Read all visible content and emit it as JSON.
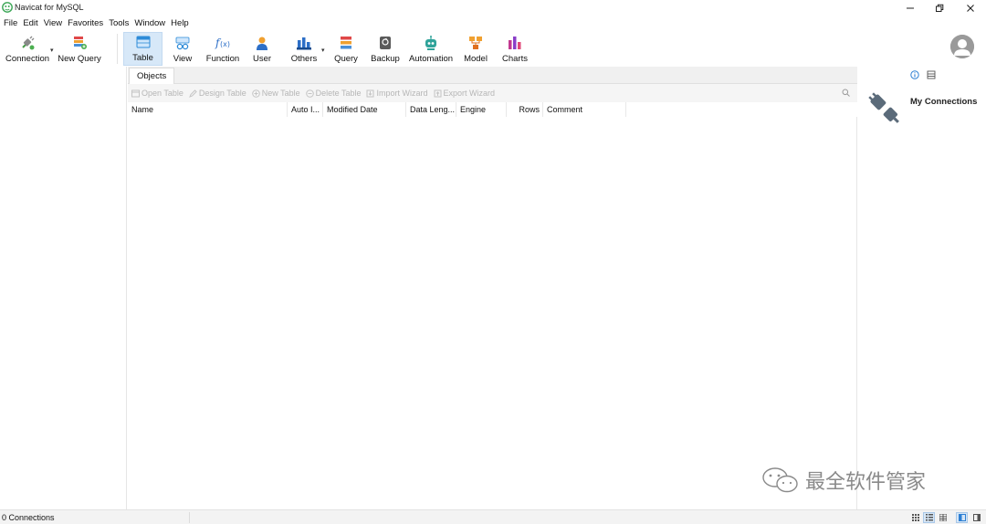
{
  "window": {
    "title": "Navicat for MySQL"
  },
  "menu": [
    "File",
    "Edit",
    "View",
    "Favorites",
    "Tools",
    "Window",
    "Help"
  ],
  "toolbar": {
    "connection": "Connection",
    "new_query": "New Query",
    "table": "Table",
    "view": "View",
    "function": "Function",
    "user": "User",
    "others": "Others",
    "query": "Query",
    "backup": "Backup",
    "automation": "Automation",
    "model": "Model",
    "charts": "Charts",
    "active": "Table"
  },
  "main": {
    "tab": "Objects",
    "actions": [
      "Open Table",
      "Design Table",
      "New Table",
      "Delete Table",
      "Import Wizard",
      "Export Wizard"
    ],
    "columns": [
      "Name",
      "Auto I...",
      "Modified Date",
      "Data Leng...",
      "Engine",
      "Rows",
      "Comment"
    ]
  },
  "right_panel": {
    "title": "My Connections"
  },
  "watermark": {
    "text": "最全软件管家"
  },
  "status": {
    "connections": "0 Connections"
  },
  "colors": {
    "active_tab_bg": "#d7e8f8",
    "disabled_text": "#b6b6b6",
    "statusbar_bg": "#f3f3f3"
  }
}
